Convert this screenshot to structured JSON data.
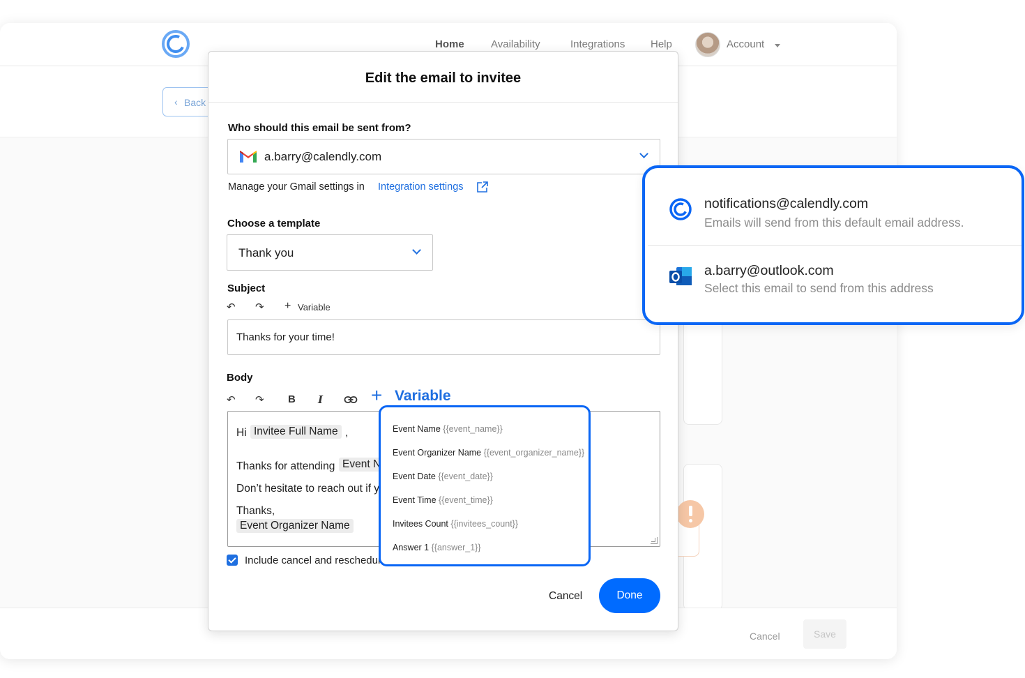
{
  "nav": {
    "home": "Home",
    "availability": "Availability",
    "integrations": "Integrations",
    "help": "Help",
    "account": "Account"
  },
  "back_button": "Back",
  "footer": {
    "cancel": "Cancel",
    "save": "Save"
  },
  "modal": {
    "title": "Edit the email to invitee",
    "from_label": "Who should this email be sent from?",
    "from_value": "a.barry@calendly.com",
    "gmail_help": "Manage your Gmail settings in",
    "gmail_help_link": "Integration settings",
    "template_label": "Choose a template",
    "template_value": "Thank you",
    "subject_label": "Subject",
    "subject_variable": "Variable",
    "subject_value": "Thanks for your time!",
    "body_label": "Body",
    "body_variable": "Variable",
    "body": {
      "greeting": "Hi",
      "greeting_comma": ",",
      "invitee_pill": "Invitee Full Name",
      "thanks_line": "Thanks for attending",
      "event_pill": "Event N",
      "reach_line": "Don’t hesitate to reach out if y",
      "signoff": "Thanks,",
      "organizer_pill": "Event Organizer Name"
    },
    "checkbox_label": "Include cancel and reschedule",
    "checkbox_checked": true,
    "cancel": "Cancel",
    "done": "Done"
  },
  "variables": [
    {
      "name": "Event Name",
      "code": "{{event_name}}"
    },
    {
      "name": "Event Organizer Name",
      "code": "{{event_organizer_name}}"
    },
    {
      "name": "Event Date",
      "code": "{{event_date}}"
    },
    {
      "name": "Event Time",
      "code": "{{event_time}}"
    },
    {
      "name": "Invitees Count",
      "code": "{{invitees_count}}"
    },
    {
      "name": "Answer 1",
      "code": "{{answer_1}}"
    }
  ],
  "email_options": [
    {
      "address": "notifications@calendly.com",
      "description": "Emails will send from this default email address.",
      "icon": "calendly-icon"
    },
    {
      "address": "a.barry@outlook.com",
      "description": "Select this email to send from this address",
      "icon": "outlook-icon"
    }
  ],
  "colors": {
    "accent": "#006bff",
    "highlight_border": "#0a66f5",
    "warning": "#f6c7a6"
  }
}
